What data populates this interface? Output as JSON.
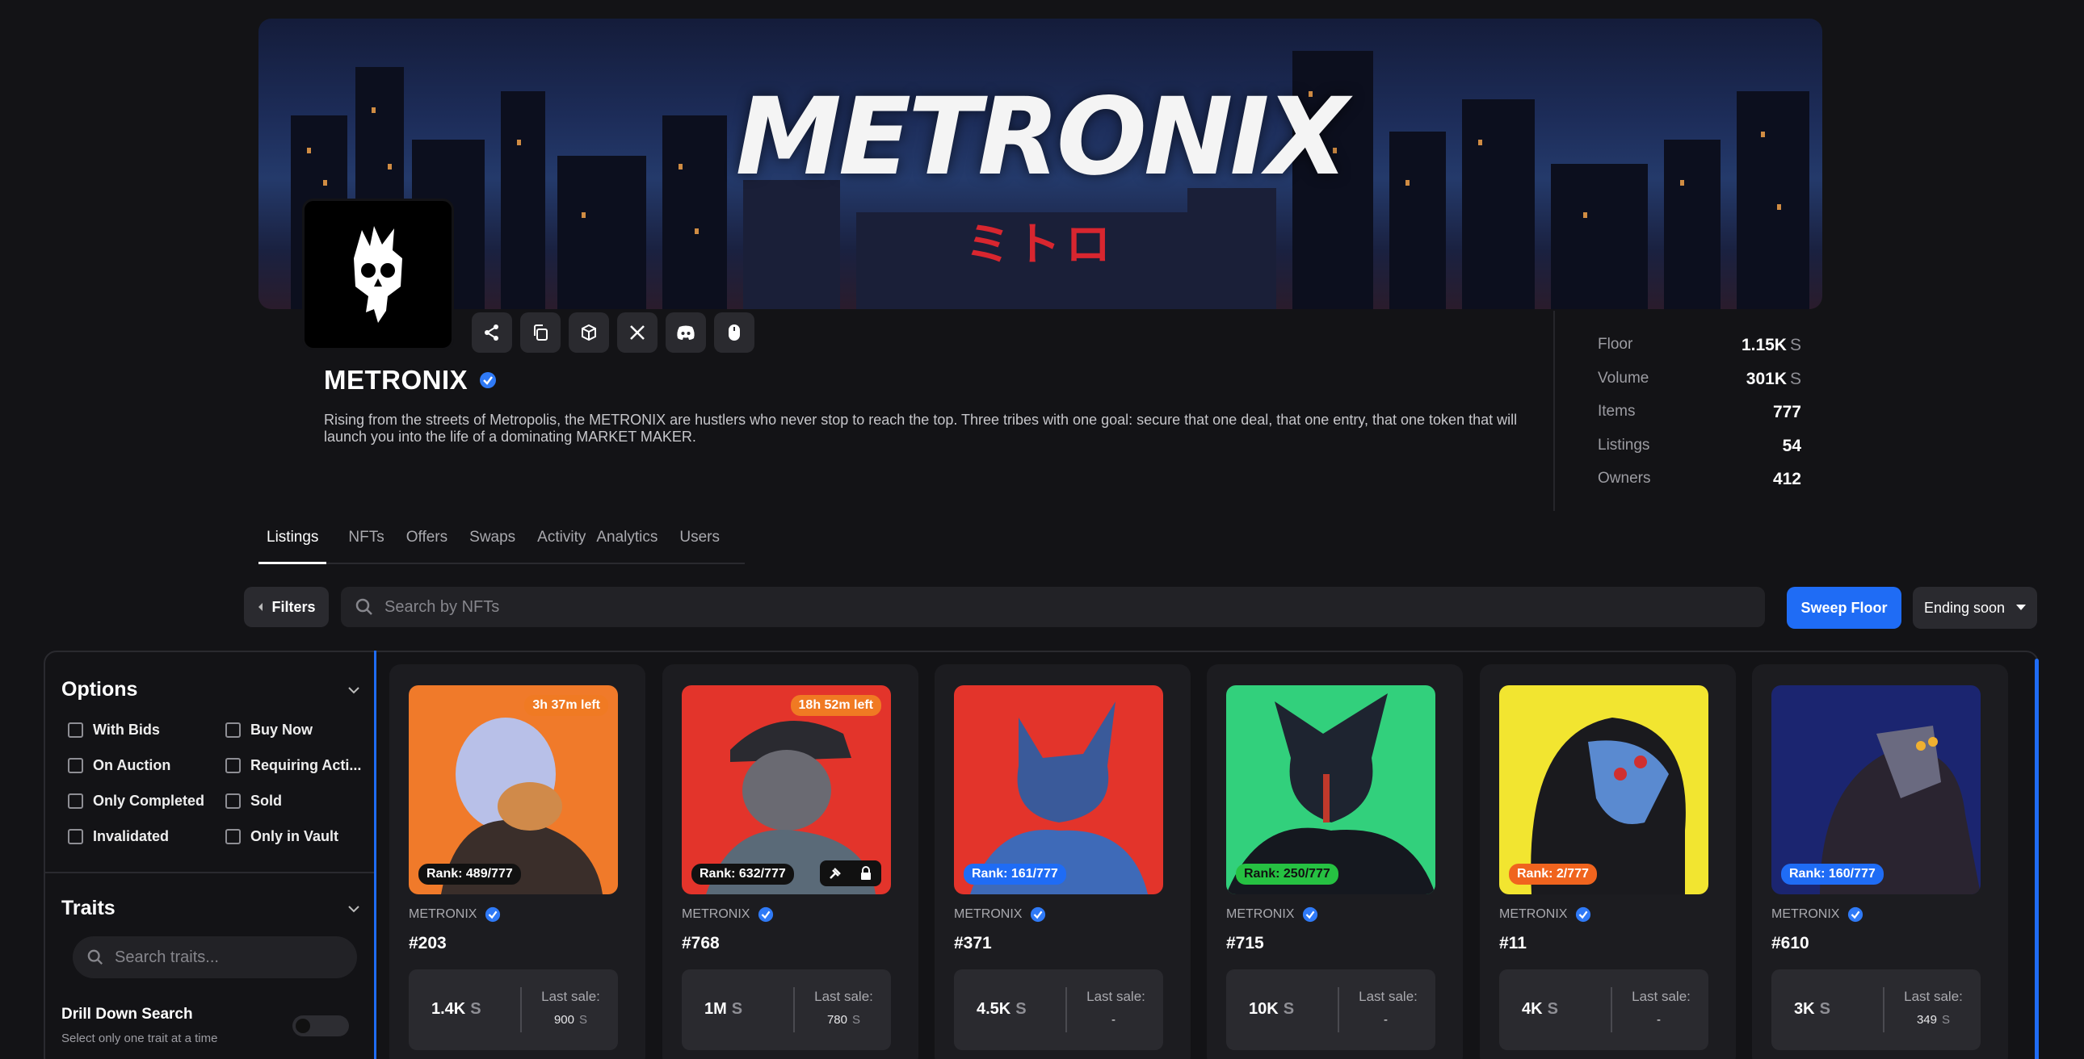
{
  "banner": {
    "logo_text": "METRONIX",
    "logo_sub": "ミトロ"
  },
  "socials": [
    "share-icon",
    "copy-icon",
    "cube-icon",
    "x-icon",
    "discord-icon",
    "mouse-icon"
  ],
  "collection": {
    "name": "METRONIX",
    "description": "Rising from the streets of Metropolis, the METRONIX are hustlers who never stop to reach the top. Three tribes with one goal: secure that one deal, that one entry, that one token that will launch you into the life of a dominating MARKET MAKER."
  },
  "stats": [
    {
      "label": "Floor",
      "value": "1.15K",
      "unit": "S"
    },
    {
      "label": "Volume",
      "value": "301K",
      "unit": "S"
    },
    {
      "label": "Items",
      "value": "777",
      "unit": ""
    },
    {
      "label": "Listings",
      "value": "54",
      "unit": ""
    },
    {
      "label": "Owners",
      "value": "412",
      "unit": ""
    }
  ],
  "tabs": [
    "Listings",
    "NFTs",
    "Offers",
    "Swaps",
    "Activity",
    "Analytics",
    "Users"
  ],
  "toolbar": {
    "filters_label": "Filters",
    "search_placeholder": "Search by NFTs",
    "sweep_label": "Sweep Floor",
    "sort_label": "Ending soon"
  },
  "sidebar": {
    "options_title": "Options",
    "options": [
      "With Bids",
      "Buy Now",
      "On Auction",
      "Requiring Acti...",
      "Only Completed",
      "Sold",
      "Invalidated",
      "Only in Vault"
    ],
    "traits_title": "Traits",
    "traits_placeholder": "Search traits...",
    "drill_title": "Drill Down Search",
    "drill_sub": "Select only one trait at a time"
  },
  "cards": [
    {
      "collection": "METRONIX",
      "id": "#203",
      "timer": "3h 37m left",
      "rank": "Rank: 489/777",
      "rank_color": "#111111",
      "bg": "#f07a2a",
      "price": "1.4K",
      "unit": "S",
      "last_label": "Last sale:",
      "last_sale": "900",
      "last_unit": "S",
      "locked": false
    },
    {
      "collection": "METRONIX",
      "id": "#768",
      "timer": "18h 52m left",
      "rank": "Rank: 632/777",
      "rank_color": "#111111",
      "bg": "#e3342b",
      "price": "1M",
      "unit": "S",
      "last_label": "Last sale:",
      "last_sale": "780",
      "last_unit": "S",
      "locked": true
    },
    {
      "collection": "METRONIX",
      "id": "#371",
      "timer": "",
      "rank": "Rank: 161/777",
      "rank_color": "#1f6cf5",
      "bg": "#e3342b",
      "price": "4.5K",
      "unit": "S",
      "last_label": "Last sale:",
      "last_sale": "-",
      "last_unit": "",
      "locked": false
    },
    {
      "collection": "METRONIX",
      "id": "#715",
      "timer": "",
      "rank": "Rank: 250/777",
      "rank_color": "#26c142",
      "bg": "#32d07c",
      "price": "10K",
      "unit": "S",
      "last_label": "Last sale:",
      "last_sale": "-",
      "last_unit": "",
      "locked": false
    },
    {
      "collection": "METRONIX",
      "id": "#11",
      "timer": "",
      "rank": "Rank: 2/777",
      "rank_color": "#f0641e",
      "bg": "#f2e530",
      "price": "4K",
      "unit": "S",
      "last_label": "Last sale:",
      "last_sale": "-",
      "last_unit": "",
      "locked": false
    },
    {
      "collection": "METRONIX",
      "id": "#610",
      "timer": "",
      "rank": "Rank: 160/777",
      "rank_color": "#1f6cf5",
      "bg": "#1b2570",
      "price": "3K",
      "unit": "S",
      "last_label": "Last sale:",
      "last_sale": "349",
      "last_unit": "S",
      "locked": false
    }
  ]
}
